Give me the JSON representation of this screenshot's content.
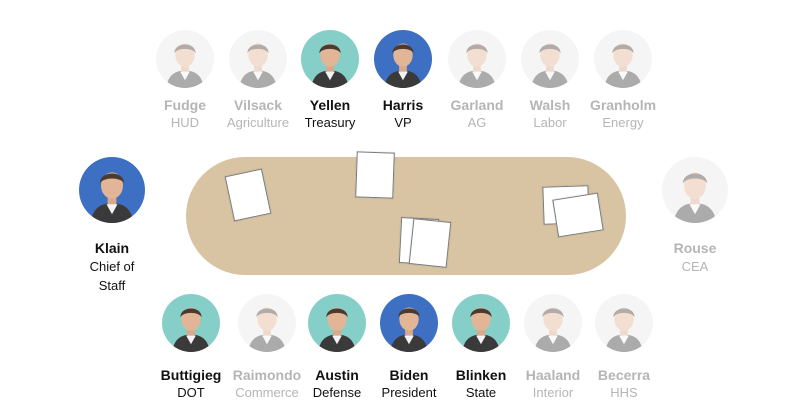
{
  "top_row": [
    {
      "name": "Fudge",
      "role": "HUD",
      "highlight": false,
      "bg": "grey"
    },
    {
      "name": "Vilsack",
      "role": "Agriculture",
      "highlight": false,
      "bg": "grey"
    },
    {
      "name": "Yellen",
      "role": "Treasury",
      "highlight": true,
      "bg": "teal"
    },
    {
      "name": "Harris",
      "role": "VP",
      "highlight": true,
      "bg": "blue"
    },
    {
      "name": "Garland",
      "role": "AG",
      "highlight": false,
      "bg": "grey"
    },
    {
      "name": "Walsh",
      "role": "Labor",
      "highlight": false,
      "bg": "grey"
    },
    {
      "name": "Granholm",
      "role": "Energy",
      "highlight": false,
      "bg": "grey"
    }
  ],
  "left_seat": {
    "name": "Klain",
    "role_line1": "Chief of",
    "role_line2": "Staff",
    "highlight": true,
    "bg": "blue"
  },
  "right_seat": {
    "name": "Rouse",
    "role": "CEA",
    "highlight": false,
    "bg": "grey"
  },
  "bottom_row": [
    {
      "name": "Buttigieg",
      "role": "DOT",
      "highlight": true,
      "bg": "teal"
    },
    {
      "name": "Raimondo",
      "role": "Commerce",
      "highlight": false,
      "bg": "grey"
    },
    {
      "name": "Austin",
      "role": "Defense",
      "highlight": true,
      "bg": "teal"
    },
    {
      "name": "Biden",
      "role": "President",
      "highlight": true,
      "bg": "blue"
    },
    {
      "name": "Blinken",
      "role": "State",
      "highlight": true,
      "bg": "teal"
    },
    {
      "name": "Haaland",
      "role": "Interior",
      "highlight": false,
      "bg": "grey"
    },
    {
      "name": "Becerra",
      "role": "HHS",
      "highlight": false,
      "bg": "grey"
    }
  ],
  "colors": {
    "table": "#d8c4a3",
    "teal": "#86cfc9",
    "blue": "#3d6fc2",
    "dim_text": "#b5b5b5"
  }
}
